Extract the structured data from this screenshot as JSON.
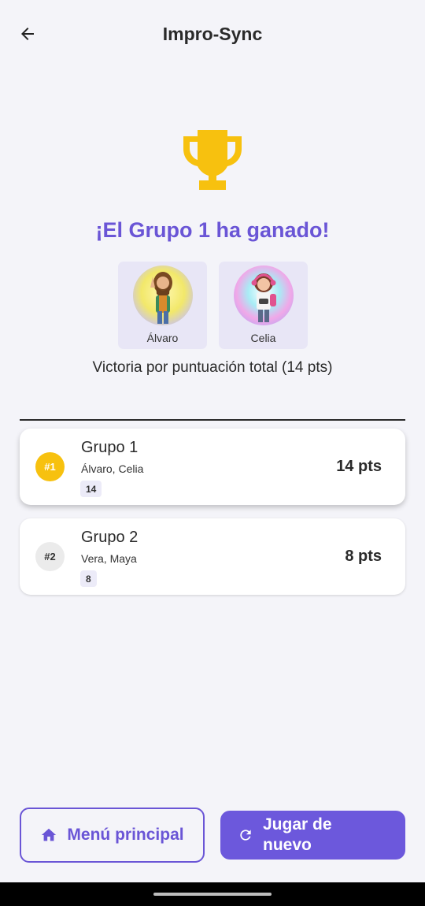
{
  "header": {
    "title": "Impro-Sync",
    "back_icon": "arrow-left-icon"
  },
  "result": {
    "trophy_icon": "trophy-icon",
    "winner_title": "¡El Grupo 1 ha ganado!",
    "victory_text": "Victoria por puntuación total (14 pts)",
    "winners": [
      {
        "name": "Álvaro",
        "avatar": "bearded-man-avatar"
      },
      {
        "name": "Celia",
        "avatar": "girl-gamer-avatar"
      }
    ]
  },
  "groups": [
    {
      "rank": "#1",
      "name": "Grupo 1",
      "members": "Álvaro, Celia",
      "score": "14",
      "points": "14 pts"
    },
    {
      "rank": "#2",
      "name": "Grupo 2",
      "members": "Vera, Maya",
      "score": "8",
      "points": "8 pts"
    }
  ],
  "actions": {
    "menu_label": "Menú principal",
    "menu_icon": "home-icon",
    "play_again_label": "Jugar de nuevo",
    "play_again_icon": "refresh-icon"
  },
  "colors": {
    "accent": "#6a55d6",
    "gold": "#f7c10f",
    "background": "#f4f4f9"
  }
}
